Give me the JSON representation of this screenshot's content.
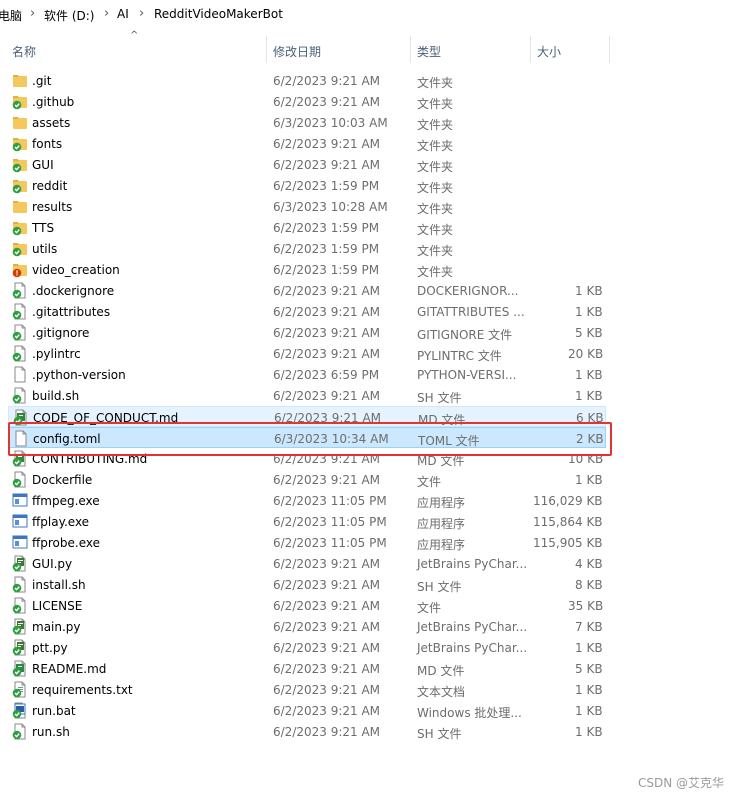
{
  "breadcrumb": [
    "电脑",
    "软件 (D:)",
    "AI",
    "RedditVideoMakerBot"
  ],
  "columns": {
    "name": "名称",
    "date": "修改日期",
    "type": "类型",
    "size": "大小"
  },
  "files": [
    {
      "name": ".git",
      "date": "6/2/2023 9:21 AM",
      "type": "文件夹",
      "size": "",
      "icon": "folder-icon"
    },
    {
      "name": ".github",
      "date": "6/2/2023 9:21 AM",
      "type": "文件夹",
      "size": "",
      "icon": "folder-synced-icon"
    },
    {
      "name": "assets",
      "date": "6/3/2023 10:03 AM",
      "type": "文件夹",
      "size": "",
      "icon": "folder-icon"
    },
    {
      "name": "fonts",
      "date": "6/2/2023 9:21 AM",
      "type": "文件夹",
      "size": "",
      "icon": "folder-synced-icon"
    },
    {
      "name": "GUI",
      "date": "6/2/2023 9:21 AM",
      "type": "文件夹",
      "size": "",
      "icon": "folder-synced-icon"
    },
    {
      "name": "reddit",
      "date": "6/2/2023 1:59 PM",
      "type": "文件夹",
      "size": "",
      "icon": "folder-synced-icon"
    },
    {
      "name": "results",
      "date": "6/3/2023 10:28 AM",
      "type": "文件夹",
      "size": "",
      "icon": "folder-icon"
    },
    {
      "name": "TTS",
      "date": "6/2/2023 1:59 PM",
      "type": "文件夹",
      "size": "",
      "icon": "folder-synced-icon"
    },
    {
      "name": "utils",
      "date": "6/2/2023 1:59 PM",
      "type": "文件夹",
      "size": "",
      "icon": "folder-synced-icon"
    },
    {
      "name": "video_creation",
      "date": "6/2/2023 1:59 PM",
      "type": "文件夹",
      "size": "",
      "icon": "folder-error-icon"
    },
    {
      "name": ".dockerignore",
      "date": "6/2/2023 9:21 AM",
      "type": "DOCKERIGNOR...",
      "size": "1 KB",
      "icon": "file-synced-icon"
    },
    {
      "name": ".gitattributes",
      "date": "6/2/2023 9:21 AM",
      "type": "GITATTRIBUTES ...",
      "size": "1 KB",
      "icon": "file-synced-icon"
    },
    {
      "name": ".gitignore",
      "date": "6/2/2023 9:21 AM",
      "type": "GITIGNORE 文件",
      "size": "5 KB",
      "icon": "file-synced-icon"
    },
    {
      "name": ".pylintrc",
      "date": "6/2/2023 9:21 AM",
      "type": "PYLINTRC 文件",
      "size": "20 KB",
      "icon": "file-synced-icon"
    },
    {
      "name": ".python-version",
      "date": "6/2/2023 6:59 PM",
      "type": "PYTHON-VERSI...",
      "size": "1 KB",
      "icon": "file-icon"
    },
    {
      "name": "build.sh",
      "date": "6/2/2023 9:21 AM",
      "type": "SH 文件",
      "size": "1 KB",
      "icon": "file-synced-icon"
    },
    {
      "name": "CODE_OF_CONDUCT.md",
      "date": "6/2/2023 9:21 AM",
      "type": "MD 文件",
      "size": "6 KB",
      "icon": "markdown-synced-icon"
    },
    {
      "name": "config.toml",
      "date": "6/3/2023 10:34 AM",
      "type": "TOML 文件",
      "size": "2 KB",
      "icon": "file-icon"
    },
    {
      "name": "CONTRIBUTING.md",
      "date": "6/2/2023 9:21 AM",
      "type": "MD 文件",
      "size": "10 KB",
      "icon": "markdown-synced-icon"
    },
    {
      "name": "Dockerfile",
      "date": "6/2/2023 9:21 AM",
      "type": "文件",
      "size": "1 KB",
      "icon": "file-synced-icon"
    },
    {
      "name": "ffmpeg.exe",
      "date": "6/2/2023 11:05 PM",
      "type": "应用程序",
      "size": "116,029 KB",
      "icon": "exe-icon"
    },
    {
      "name": "ffplay.exe",
      "date": "6/2/2023 11:05 PM",
      "type": "应用程序",
      "size": "115,864 KB",
      "icon": "exe-icon"
    },
    {
      "name": "ffprobe.exe",
      "date": "6/2/2023 11:05 PM",
      "type": "应用程序",
      "size": "115,905 KB",
      "icon": "exe-icon"
    },
    {
      "name": "GUI.py",
      "date": "6/2/2023 9:21 AM",
      "type": "JetBrains PyChar...",
      "size": "4 KB",
      "icon": "pycharm-synced-icon"
    },
    {
      "name": "install.sh",
      "date": "6/2/2023 9:21 AM",
      "type": "SH 文件",
      "size": "8 KB",
      "icon": "file-synced-icon"
    },
    {
      "name": "LICENSE",
      "date": "6/2/2023 9:21 AM",
      "type": "文件",
      "size": "35 KB",
      "icon": "file-synced-icon"
    },
    {
      "name": "main.py",
      "date": "6/2/2023 9:21 AM",
      "type": "JetBrains PyChar...",
      "size": "7 KB",
      "icon": "pycharm-synced-icon"
    },
    {
      "name": "ptt.py",
      "date": "6/2/2023 9:21 AM",
      "type": "JetBrains PyChar...",
      "size": "1 KB",
      "icon": "pycharm-synced-icon"
    },
    {
      "name": "README.md",
      "date": "6/2/2023 9:21 AM",
      "type": "MD 文件",
      "size": "5 KB",
      "icon": "markdown-synced-icon"
    },
    {
      "name": "requirements.txt",
      "date": "6/2/2023 9:21 AM",
      "type": "文本文档",
      "size": "1 KB",
      "icon": "text-synced-icon"
    },
    {
      "name": "run.bat",
      "date": "6/2/2023 9:21 AM",
      "type": "Windows 批处理...",
      "size": "1 KB",
      "icon": "bat-synced-icon"
    },
    {
      "name": "run.sh",
      "date": "6/2/2023 9:21 AM",
      "type": "SH 文件",
      "size": "1 KB",
      "icon": "file-synced-icon"
    }
  ],
  "selected_file": "config.toml",
  "hovered_file": "CODE_OF_CONDUCT.md",
  "watermark": "CSDN @艾克华",
  "colors": {
    "selection": "#cce8ff",
    "hover": "#e5f3ff",
    "highlight_box": "#e3342f",
    "sync_ok": "#2e9e3e",
    "sync_error": "#d83b01",
    "folder": "#f4c85c"
  }
}
